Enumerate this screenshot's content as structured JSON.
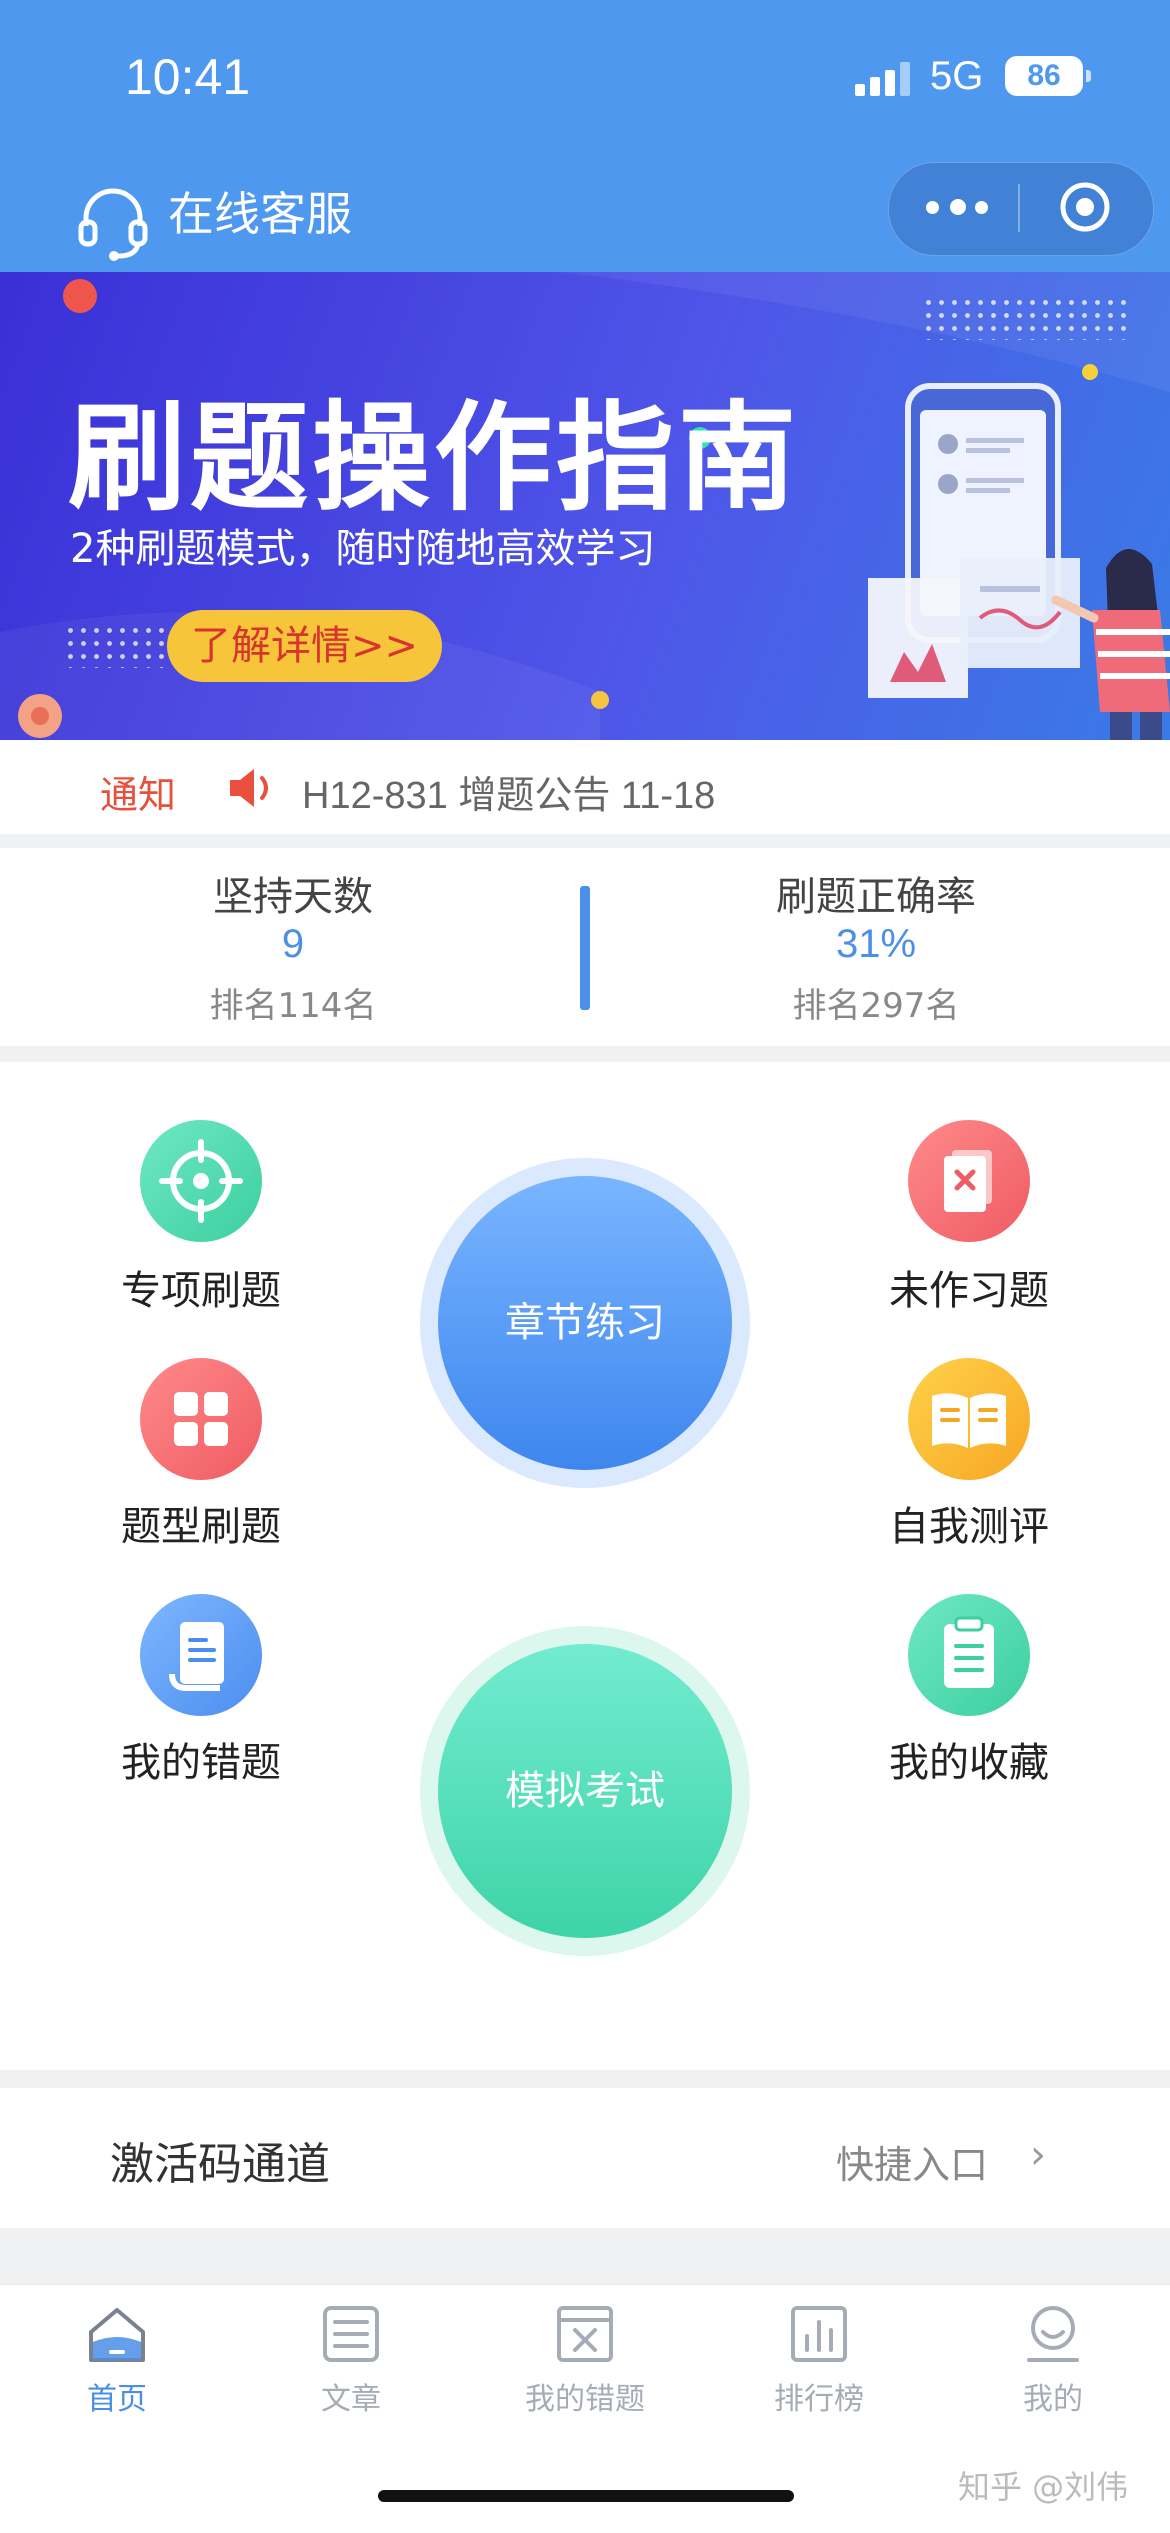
{
  "status_bar": {
    "time": "10:41",
    "network": "5G",
    "battery": "86"
  },
  "header": {
    "service_label": "在线客服"
  },
  "banner": {
    "title": "刷题操作指南",
    "subtitle": "2种刷题模式，随时随地高效学习",
    "button_label": "了解详情>>"
  },
  "notice": {
    "label": "通知",
    "text": "H12-831 增题公告 11-18"
  },
  "stats": {
    "left": {
      "label": "坚持天数",
      "value": "9",
      "rank": "排名114名"
    },
    "right": {
      "label": "刷题正确率",
      "value": "31%",
      "rank": "排名297名"
    }
  },
  "grid": {
    "special_practice": "专项刷题",
    "undone_questions": "未作习题",
    "type_practice": "题型刷题",
    "self_assessment": "自我测评",
    "my_mistakes": "我的错题",
    "my_favorites": "我的收藏",
    "chapter_practice": "章节练习",
    "mock_exam": "模拟考试"
  },
  "activation": {
    "label": "激活码通道",
    "link": "快捷入口",
    "chevron": "›"
  },
  "tabs": [
    {
      "label": "首页",
      "icon": "home-icon",
      "active": true
    },
    {
      "label": "文章",
      "icon": "article-icon",
      "active": false
    },
    {
      "label": "我的错题",
      "icon": "mistakes-icon",
      "active": false
    },
    {
      "label": "排行榜",
      "icon": "ranking-icon",
      "active": false
    },
    {
      "label": "我的",
      "icon": "profile-icon",
      "active": false
    }
  ],
  "watermark": "知乎 @刘伟",
  "colors": {
    "header_blue": "#4f98f0",
    "accent_blue": "#4a8ee6",
    "notice_red": "#e8503d",
    "teal": "#4fd6b2",
    "banner_button": "#f7c53a"
  }
}
